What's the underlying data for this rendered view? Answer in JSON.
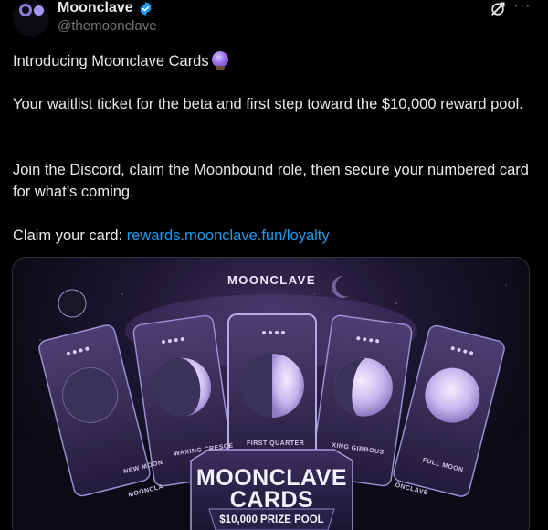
{
  "author": {
    "display_name": "Moonclave",
    "handle": "@themoonclave",
    "verified": true
  },
  "icons": {
    "avatar": "moonclave-logo-icon",
    "verified": "verified-badge-icon",
    "grok": "grok-icon",
    "more": "more-options-icon"
  },
  "post": {
    "line1": "Introducing Moonclave Cards",
    "line1_emoji": "crystal-ball-icon",
    "para2": "Your waitlist ticket for the beta and first step toward the $10,000 reward pool.",
    "para3": "Join the Discord, claim the Moonbound role, then secure your numbered card for what’s coming.",
    "claim_prefix": "Claim your card: ",
    "claim_link": "rewards.moonclave.fun/loyalty"
  },
  "media": {
    "brand": "MOONCLAVE",
    "title_line1": "MOONCLAVE",
    "title_line2": "CARDS",
    "prize": "$10,000 PRIZE POOL",
    "cards": [
      {
        "label": "NEW MOON"
      },
      {
        "label": "WAXING CRESCE"
      },
      {
        "label": "FIRST QUARTER"
      },
      {
        "label": "XING GIBBOUS"
      },
      {
        "label": "FULL MOON"
      }
    ],
    "card_brand_left": "MOONCLA",
    "card_brand_right": "ONCLAVE"
  },
  "colors": {
    "background": "#000000",
    "text": "#e7e9ea",
    "muted": "#71767b",
    "link": "#1d9bf0",
    "verified": "#1d9bf0",
    "accent_purple": "#8e7bd9"
  }
}
